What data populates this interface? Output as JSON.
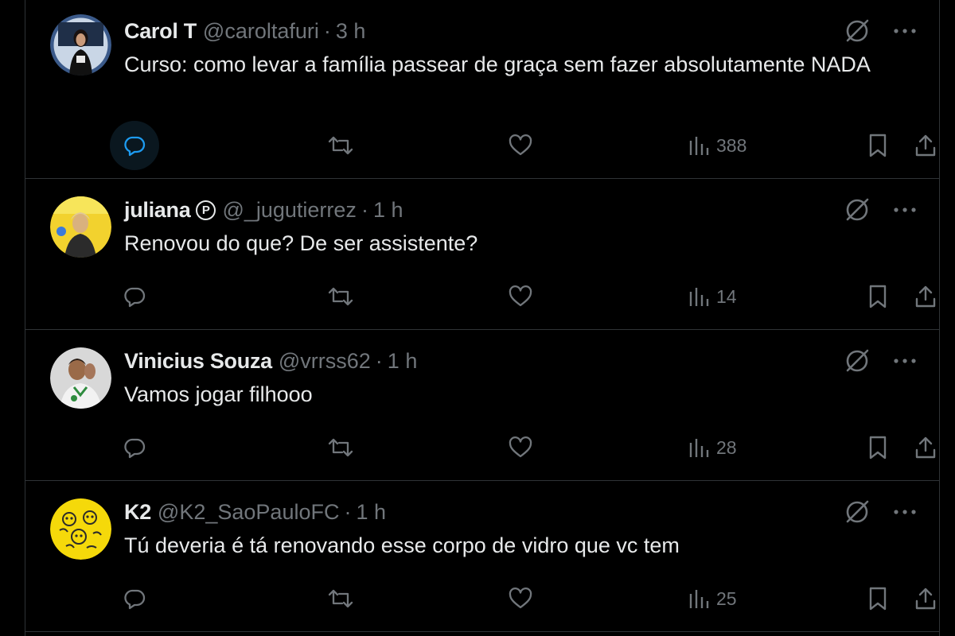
{
  "colors": {
    "background": "#000000",
    "divider": "#2f3336",
    "text_primary": "#e7e9ea",
    "text_secondary": "#71767b",
    "reply_hover": "#0a171f",
    "reply_hover_icon": "#1d9bf0"
  },
  "tweets": [
    {
      "name": "Carol T",
      "handle": "@caroltafuri",
      "separator": "·",
      "time": "3 h",
      "text": "Curso: como levar a família passear de graça sem fazer absolutamente NADA",
      "views": "388",
      "avatar_icon": "avatar-photo-woman"
    },
    {
      "name": "juliana",
      "badge": "P",
      "handle": "@_jugutierrez",
      "separator": "·",
      "time": "1 h",
      "text": "Renovou do que? De ser assistente?",
      "views": "14",
      "avatar_icon": "avatar-photo-woman-yellow"
    },
    {
      "name": "Vinicius Souza",
      "handle": "@vrrss62",
      "separator": "·",
      "time": "1 h",
      "text": "Vamos jogar filhooo",
      "views": "28",
      "avatar_icon": "avatar-photo-man"
    },
    {
      "name": "K2",
      "handle": "@K2_SaoPauloFC",
      "separator": "·",
      "time": "1 h",
      "text": "Tú deveria é tá renovando esse corpo de vidro que vc tem",
      "views": "25",
      "avatar_icon": "avatar-yellow-illustration"
    }
  ]
}
